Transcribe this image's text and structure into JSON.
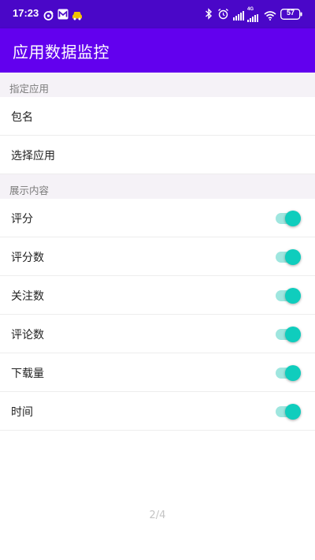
{
  "status_bar": {
    "time": "17:23",
    "battery": "57",
    "network_label": "4G",
    "icons": [
      "weibo-icon",
      "mail-icon",
      "car-icon",
      "bluetooth-icon",
      "alarm-icon",
      "signal-icon",
      "signal-icon",
      "wifi-icon",
      "battery-icon"
    ]
  },
  "app_bar": {
    "title": "应用数据监控",
    "color": "#6200ee"
  },
  "sections": {
    "app": {
      "header": "指定应用",
      "items": {
        "package_name": "包名",
        "select_app": "选择应用"
      }
    },
    "display": {
      "header": "展示内容",
      "items": [
        {
          "label": "评分",
          "on": true
        },
        {
          "label": "评分数",
          "on": true
        },
        {
          "label": "关注数",
          "on": true
        },
        {
          "label": "评论数",
          "on": true
        },
        {
          "label": "下载量",
          "on": true
        },
        {
          "label": "时间",
          "on": true
        }
      ]
    }
  },
  "footer": {
    "page_indicator": "2/4"
  },
  "colors": {
    "accent": "#0fcdbd",
    "track": "#9fe6df",
    "section_bg": "#f5f2f7",
    "status_bar": "#4a07c8"
  }
}
